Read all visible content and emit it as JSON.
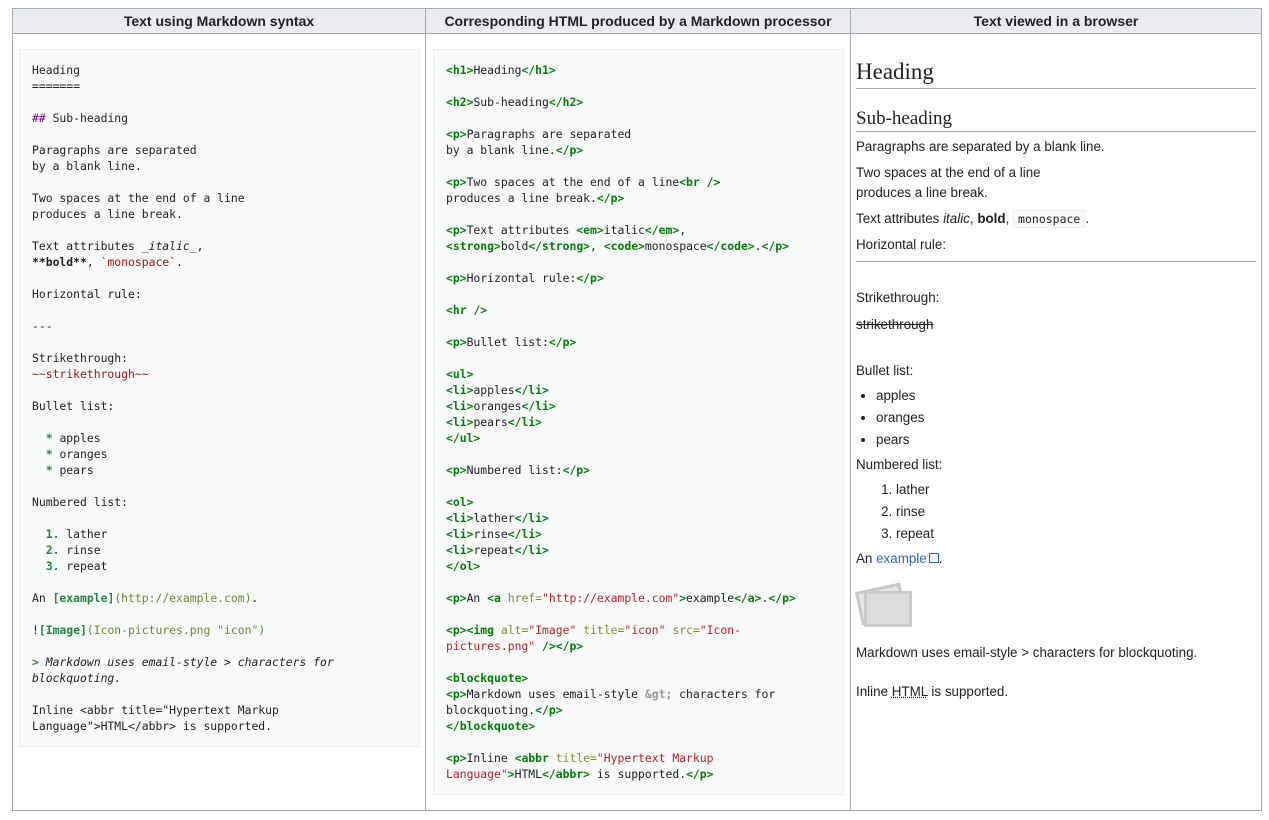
{
  "headers": {
    "col1": "Text using Markdown syntax",
    "col2": "Corresponding HTML produced by a Markdown processor",
    "col3": "Text viewed in a browser"
  },
  "markdown": {
    "heading": "Heading",
    "heading_underline": "=======",
    "subheading_marker": "##",
    "subheading": "Sub-heading",
    "para1_line1": "Paragraphs are separated",
    "para1_line2": "by a blank line.",
    "para2_line1": "Two spaces at the end of a line",
    "para2_line2": "produces a line break.",
    "attrs_prefix": "Text attributes ",
    "attrs_italic": "_italic_",
    "attrs_comma": ",",
    "attrs_bold": "**bold**",
    "attrs_sep": ", ",
    "attrs_mono": "`monospace`",
    "attrs_end": ".",
    "hr_label": "Horizontal rule:",
    "hr_marker": "---",
    "strike_label": "Strikethrough:",
    "strike_value": "~~strikethrough~~",
    "bullet_label": "Bullet list:",
    "bullets": [
      {
        "marker": "*",
        "text": "apples"
      },
      {
        "marker": "*",
        "text": "oranges"
      },
      {
        "marker": "*",
        "text": "pears"
      }
    ],
    "numbered_label": "Numbered list:",
    "numbered": [
      {
        "marker": "1.",
        "text": "lather"
      },
      {
        "marker": "2.",
        "text": "rinse"
      },
      {
        "marker": "3.",
        "text": "repeat"
      }
    ],
    "link_prefix": "An ",
    "link_text": "[example]",
    "link_url": "(http://example.com)",
    "link_end": ".",
    "img_bang": "!",
    "img_alt": "[Image]",
    "img_src": "(Icon-pictures.png \"icon\")",
    "quote_marker": ">",
    "quote_line1": " Markdown uses email-style > characters for",
    "quote_line2": "blockquoting.",
    "inline_line1": "Inline <abbr title=\"Hypertext Markup",
    "inline_line2": "Language\">HTML</abbr> is supported."
  },
  "html": {
    "h1": "Heading",
    "h2": "Sub-heading",
    "p1_l1": "Paragraphs are separated",
    "p1_l2": "by a blank line.",
    "p2_l1": "Two spaces at the end of a line",
    "p2_l2": "produces a line break.",
    "p3_a": "Text attributes ",
    "p3_b": "italic",
    "p3_c": ",",
    "p3_d": "bold",
    "p3_e": ", ",
    "p3_f": "monospace",
    "p3_g": ".",
    "p4": "Horizontal rule:",
    "p5": "Bullet list:",
    "li": [
      "apples",
      "oranges",
      "pears"
    ],
    "p6": "Numbered list:",
    "ol": [
      "lather",
      "rinse",
      "repeat"
    ],
    "p7_a": "An ",
    "p7_href": "\"http://example.com\"",
    "p7_text": "example",
    "p7_end": ".",
    "img_alt": "\"Image\"",
    "img_title": "\"icon\"",
    "img_src_l1": "\"Icon-",
    "img_src_l2": "pictures.png\"",
    "bq_l1": "Markdown uses email-style ",
    "bq_ent": "&gt;",
    "bq_l1b": " characters for",
    "bq_l2": "blockquoting.",
    "inline_a": "Inline ",
    "inline_title_l1": "\"Hypertext Markup",
    "inline_title_l2": "Language\"",
    "inline_b": "HTML",
    "inline_c": " is supported."
  },
  "rendered": {
    "h1": "Heading",
    "h2": "Sub-heading",
    "p1": "Paragraphs are separated by a blank line.",
    "p2_l1": "Two spaces at the end of a line",
    "p2_l2": "produces a line break.",
    "p3_a": "Text attributes ",
    "p3_italic": "italic",
    "p3_b": ", ",
    "p3_bold": "bold",
    "p3_c": ", ",
    "p3_mono": "monospace",
    "p3_d": ".",
    "hr_label": "Horizontal rule:",
    "strike_label": "Strikethrough:",
    "strike_value": "strikethrough",
    "bullet_label": "Bullet list:",
    "bullets": [
      "apples",
      "oranges",
      "pears"
    ],
    "numbered_label": "Numbered list:",
    "numbered": [
      "lather",
      "rinse",
      "repeat"
    ],
    "link_prefix": "An ",
    "link_text": "example",
    "link_end": ".",
    "image_icon": "picture-icon",
    "blockquote": "Markdown uses email-style > characters for blockquoting.",
    "inline_a": "Inline ",
    "inline_abbr": "HTML",
    "inline_b": " is supported."
  }
}
